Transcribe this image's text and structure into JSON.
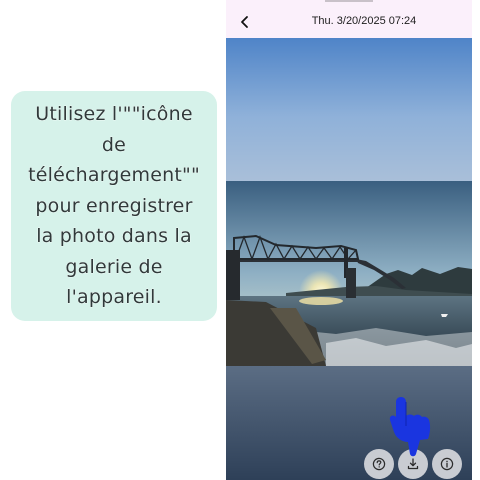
{
  "instruction": {
    "text": "Utilisez l'\"\"icône de téléchargement\"\" pour enregistrer la photo dans la galerie de l'appareil."
  },
  "header": {
    "datetime": "Thu. 3/20/2025 07:24"
  },
  "icons": {
    "back": "chevron-left-icon",
    "help": "question-circle-icon",
    "download": "download-icon",
    "info": "info-circle-icon",
    "pointer": "pointing-hand-icon"
  },
  "colors": {
    "tip_background": "#d6f2ea",
    "topbar_background": "#fbf0fb",
    "fab_background": "#c9ccd2",
    "pointer_hand": "#1a35e0"
  }
}
